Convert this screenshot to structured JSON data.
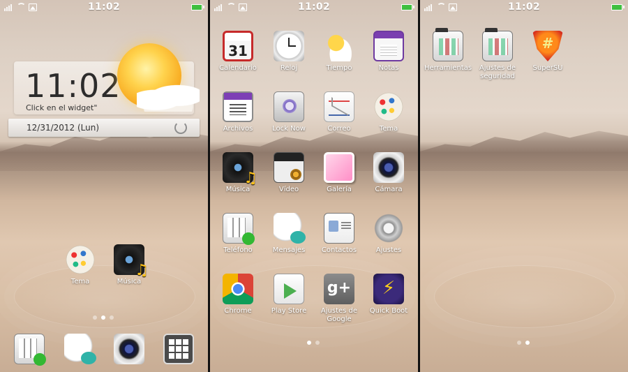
{
  "status_bar": {
    "time": "11:02"
  },
  "clock_widget": {
    "time": "11:02",
    "hint": "Click en el widget\"",
    "date": "12/31/2012 (Lun)",
    "icon": "refresh-icon"
  },
  "home_screen": {
    "apps": [
      {
        "label": "Tema",
        "icon": "theme-icon"
      },
      {
        "label": "Música",
        "icon": "music-icon"
      }
    ],
    "dock": [
      {
        "icon": "dialer-icon"
      },
      {
        "icon": "messages-icon"
      },
      {
        "icon": "camera-icon"
      },
      {
        "icon": "app-drawer-icon"
      }
    ]
  },
  "drawer_page_1": {
    "apps": [
      {
        "label": "Calendario",
        "icon": "calendar-icon",
        "day": "31"
      },
      {
        "label": "Reloj",
        "icon": "clock-icon"
      },
      {
        "label": "Tiempo",
        "icon": "weather-icon"
      },
      {
        "label": "Notas",
        "icon": "notes-icon"
      },
      {
        "label": "Archivos",
        "icon": "files-icon"
      },
      {
        "label": "Lock Now",
        "icon": "lock-icon"
      },
      {
        "label": "Correo",
        "icon": "mail-icon"
      },
      {
        "label": "Tema",
        "icon": "theme-icon"
      },
      {
        "label": "Música",
        "icon": "music-icon"
      },
      {
        "label": "Vídeo",
        "icon": "video-icon"
      },
      {
        "label": "Galería",
        "icon": "gallery-icon"
      },
      {
        "label": "Cámara",
        "icon": "camera-icon"
      },
      {
        "label": "Teléfono",
        "icon": "phone-icon"
      },
      {
        "label": "Mensajes",
        "icon": "messages-icon"
      },
      {
        "label": "Contactos",
        "icon": "contacts-icon"
      },
      {
        "label": "Ajustes",
        "icon": "settings-icon"
      },
      {
        "label": "Chrome",
        "icon": "chrome-icon"
      },
      {
        "label": "Play Store",
        "icon": "play-store-icon"
      },
      {
        "label": "Ajustes de Google",
        "icon": "google-settings-icon",
        "glyph": "g+"
      },
      {
        "label": "Quick Boot",
        "icon": "quick-boot-icon",
        "glyph": "⚡"
      }
    ]
  },
  "drawer_page_2": {
    "apps": [
      {
        "label": "Herramientas",
        "icon": "folder-icon"
      },
      {
        "label": "Ajustes de seguridad",
        "icon": "folder-icon"
      },
      {
        "label": "SuperSU",
        "icon": "supersu-icon",
        "glyph": "#"
      }
    ]
  },
  "colors": {
    "battery": "#3fbf3f",
    "wallpaper_top": "#d4c4b7",
    "wallpaper_bottom": "#c8ad95"
  }
}
